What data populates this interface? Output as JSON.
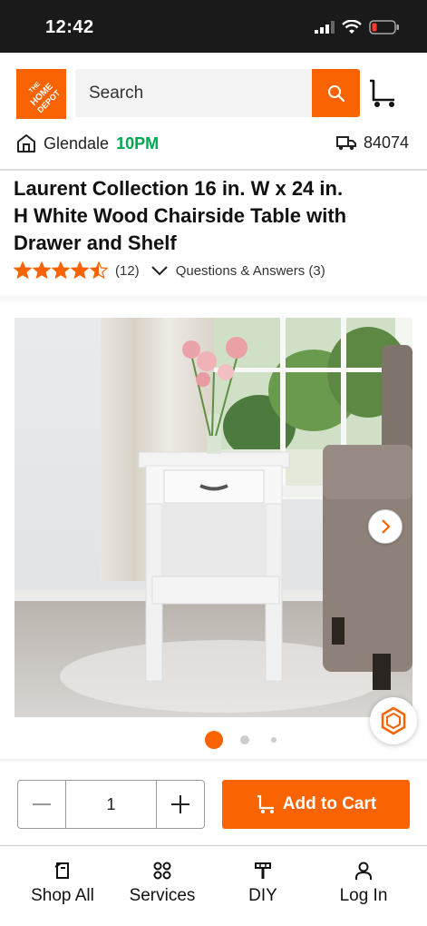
{
  "status_bar": {
    "time": "12:42"
  },
  "header": {
    "logo_text": "THE HOME DEPOT",
    "search_placeholder": "Search",
    "icons": {
      "search": "search-icon",
      "cart": "cart-icon"
    }
  },
  "store": {
    "name": "Glendale",
    "hours": "10PM",
    "zip": "84074",
    "icons": {
      "store": "store-icon",
      "delivery": "delivery-truck-icon"
    }
  },
  "product": {
    "title": "Laurent Collection 16 in. W x 24 in. H White Wood Chairside Table with Drawer and Shelf",
    "rating": 4.5,
    "rating_max": 5,
    "review_count": "(12)",
    "qa_label": "Questions & Answers (3)"
  },
  "carousel": {
    "current_index": 0,
    "total": 3
  },
  "purchase": {
    "quantity": "1",
    "add_to_cart_label": "Add to Cart"
  },
  "bottom_nav": [
    {
      "label": "Shop All",
      "icon": "shop-all-icon"
    },
    {
      "label": "Services",
      "icon": "services-icon"
    },
    {
      "label": "DIY",
      "icon": "diy-icon"
    },
    {
      "label": "Log In",
      "icon": "user-icon"
    }
  ],
  "colors": {
    "brand": "#f96302",
    "store_hours": "#00a650"
  }
}
